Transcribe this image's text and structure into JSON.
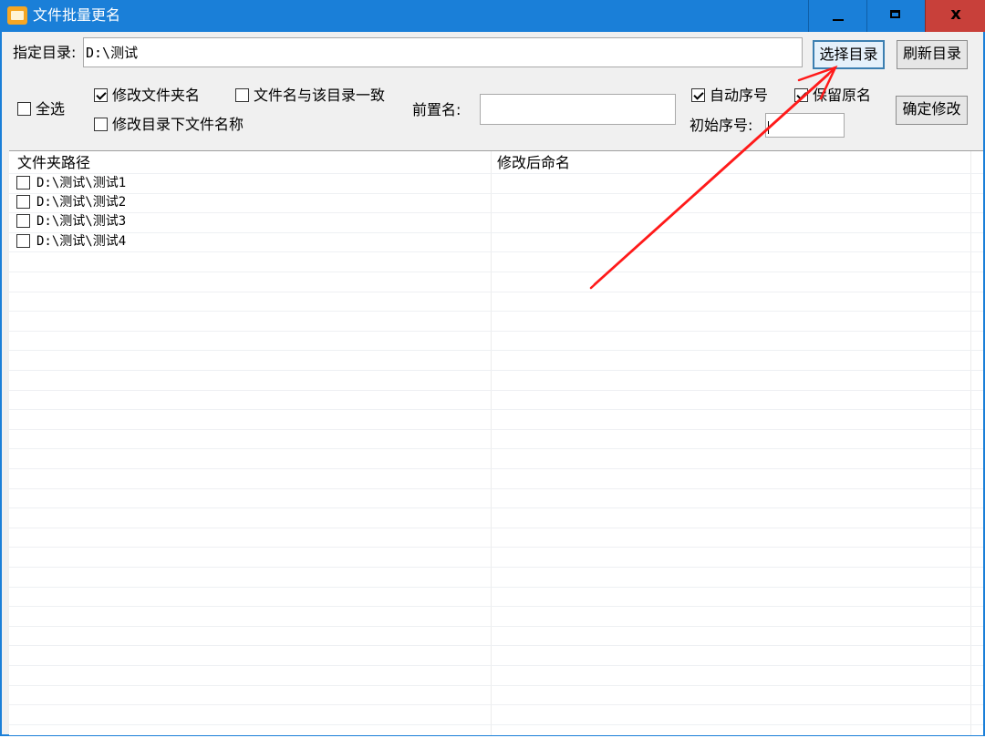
{
  "window": {
    "title": "文件批量更名",
    "buttons": {
      "minimize": "minimize",
      "maximize": "maximize",
      "close": "x"
    }
  },
  "dir_row": {
    "label": "指定目录:",
    "value": "D:\\测试",
    "select_button": "选择目录",
    "refresh_button": "刷新目录"
  },
  "options": {
    "select_all": {
      "label": "全选",
      "checked": false
    },
    "modify_folder_name": {
      "label": "修改文件夹名",
      "checked": true
    },
    "filename_same_as_dir": {
      "label": "文件名与该目录一致",
      "checked": false
    },
    "modify_files_in_dir": {
      "label": "修改目录下文件名称",
      "checked": false
    },
    "prefix_label": "前置名:",
    "prefix_value": "",
    "auto_sequence": {
      "label": "自动序号",
      "checked": true
    },
    "keep_original_name": {
      "label": "保留原名",
      "checked": true
    },
    "start_number_label": "初始序号:",
    "start_number_value": "",
    "confirm_button": "确定修改"
  },
  "list": {
    "columns": [
      "文件夹路径",
      "修改后命名"
    ],
    "rows": [
      {
        "path": "D:\\测试\\测试1",
        "new_name": "",
        "checked": false
      },
      {
        "path": "D:\\测试\\测试2",
        "new_name": "",
        "checked": false
      },
      {
        "path": "D:\\测试\\测试3",
        "new_name": "",
        "checked": false
      },
      {
        "path": "D:\\测试\\测试4",
        "new_name": "",
        "checked": false
      }
    ]
  },
  "annotation": {
    "arrow_color": "#ff1a1a",
    "points_to": "select_button"
  },
  "colors": {
    "titlebar": "#1a7fd8",
    "close_button": "#c8403a",
    "window_bg": "#f0f0f0"
  }
}
